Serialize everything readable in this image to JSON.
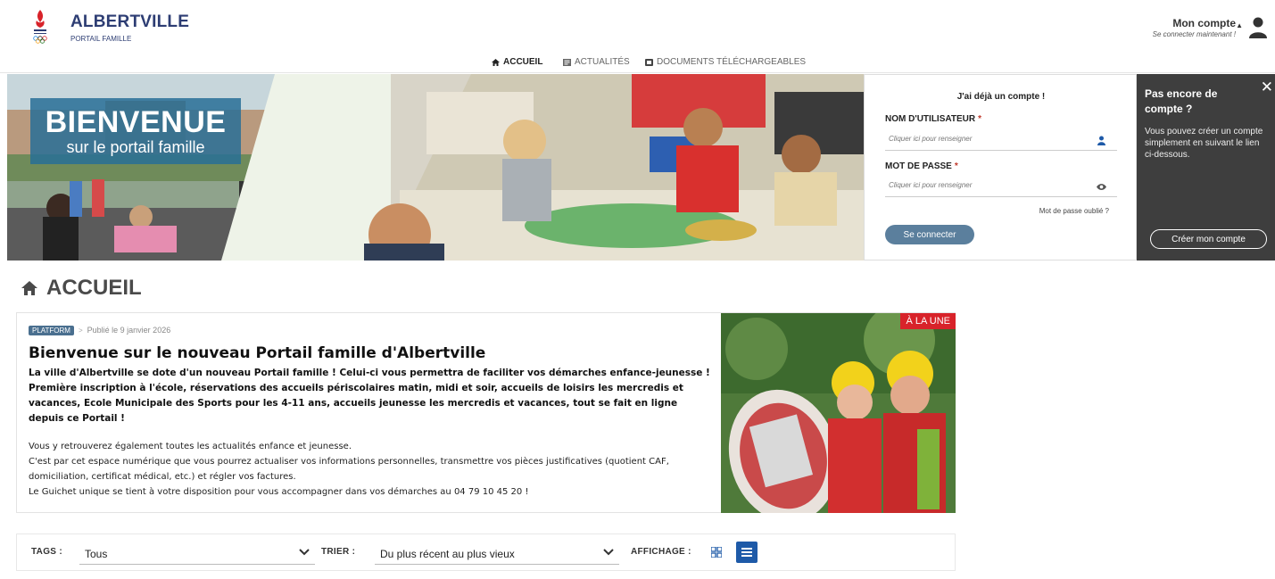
{
  "header": {
    "brand_title": "ALBERTVILLE",
    "brand_subtitle": "PORTAIL FAMILLE",
    "account_title": "Mon compte",
    "account_subtitle": "Se connecter maintenant !"
  },
  "nav": {
    "items": [
      {
        "label": "ACCUEIL",
        "icon": "home-icon"
      },
      {
        "label": "ACTUALITÉS",
        "icon": "news-icon"
      },
      {
        "label": "DOCUMENTS TÉLÉCHARGEABLES",
        "icon": "document-icon"
      }
    ]
  },
  "hero": {
    "title": "BIENVENUE",
    "subtitle": "sur le portail famille"
  },
  "login": {
    "heading": "J'ai déjà un compte !",
    "username_label": "NOM D'UTILISATEUR",
    "username_placeholder": "Cliquer ici pour renseigner",
    "password_label": "MOT DE PASSE",
    "password_placeholder": "Cliquer ici pour renseigner",
    "required_mark": "*",
    "forgot_label": "Mot de passe oublié ?",
    "connect_label": "Se connecter"
  },
  "signup": {
    "title": "Pas encore de compte ?",
    "text": "Vous pouvez créer un compte simplement en suivant le lien ci-dessous.",
    "close_label": "✕",
    "button_label": "Créer mon compte"
  },
  "page": {
    "title": "ACCUEIL"
  },
  "article": {
    "tag": "PLATFORM",
    "separator": ">",
    "date": "Publié le 9 janvier 2026",
    "title": "Bienvenue sur le nouveau Portail famille d'Albertville",
    "lead": "La ville d'Albertville se dote d'un nouveau Portail famille ! Celui-ci vous permettra de faciliter vos démarches enfance-jeunesse ! Première inscription à l'école, réservations des accueils périscolaires matin, midi et soir, accueils de loisirs les mercredis et vacances, Ecole Municipale des Sports pour les 4-11 ans, accueils jeunesse les mercredis et vacances, tout se fait en ligne depuis ce Portail !",
    "paragraph_1": "Vous y retrouverez également toutes les actualités enfance et jeunesse.",
    "paragraph_2": "C'est par cet espace numérique que vous pourrez actualiser vos informations personnelles, transmettre vos pièces justificatives (quotient CAF, domiciliation, certificat médical, etc.) et régler vos factures.",
    "paragraph_3": "Le Guichet unique se tient à votre disposition pour vous accompagner dans vos démarches au 04 79 10 45 20 !",
    "badge": "À LA UNE"
  },
  "filters": {
    "tags_label": "TAGS :",
    "tags_value": "Tous",
    "sort_label": "TRIER :",
    "sort_value": "Du plus récent au plus vieux",
    "display_label": "AFFICHAGE :",
    "active_view": "list"
  },
  "colors": {
    "brand": "#2d3d73",
    "accent": "#1e5aa8",
    "badge": "#d8232a",
    "signup_bg": "#3e3e3e"
  }
}
